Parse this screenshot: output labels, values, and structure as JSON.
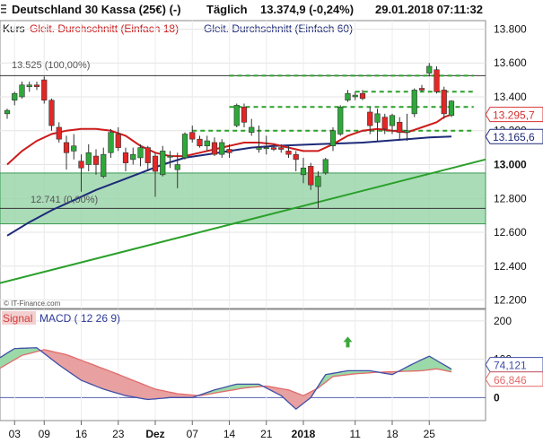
{
  "header": {
    "instrument": "Deutschland 30 Kassa (25€) (-)",
    "period": "Täglich",
    "last": "13.374,9 (-0,24%)",
    "datetime": "29.01.2018 07:11:32"
  },
  "legend": {
    "kurs": "Kurs",
    "ma_short": "Gleit. Durchschnitt (Einfach 18)",
    "ma_long": "Gleit. Durchschnitt (Einfach 60)"
  },
  "watermark": "© IT-Finance.com",
  "colors": {
    "up": "#2fa83a",
    "down": "#e32626",
    "ma18": "#cc1b1b",
    "ma60": "#1d2a78",
    "trend": "#2aa02a",
    "zone_fill": "#8fd0a0",
    "macd": "#3e4fa8",
    "signal": "#e26b6b",
    "macd_fill_up": "#9bd9a8",
    "macd_fill_down": "#e8a0a0",
    "badge_price": "#d63030",
    "badge_ma60": "#1d2a78"
  },
  "chart_data": [
    {
      "type": "candlestick",
      "title": "Deutschland 30 Kassa (25€) (-)",
      "ylim": [
        12150,
        13850
      ],
      "y_ticks": [
        "13.800",
        "13.600",
        "13.400",
        "13.200",
        "13.000",
        "12.800",
        "12.600",
        "12.400",
        "12.200"
      ],
      "y_tick_values": [
        13800,
        13600,
        13400,
        13200,
        13000,
        12800,
        12600,
        12400,
        12200
      ],
      "x_tick_labels": [
        "03",
        "09",
        "16",
        "23",
        "Dez",
        "07",
        "14",
        "21",
        "2018",
        "11",
        "18",
        "25"
      ],
      "x_tick_index": [
        1,
        5,
        10,
        15,
        20,
        25,
        30,
        35,
        40,
        47,
        52,
        57
      ],
      "candles": [
        {
          "o": 13300,
          "h": 13330,
          "l": 13270,
          "c": 13320
        },
        {
          "o": 13380,
          "h": 13430,
          "l": 13350,
          "c": 13420
        },
        {
          "o": 13400,
          "h": 13490,
          "l": 13390,
          "c": 13470
        },
        {
          "o": 13460,
          "h": 13490,
          "l": 13430,
          "c": 13470
        },
        {
          "o": 13470,
          "h": 13490,
          "l": 13440,
          "c": 13460
        },
        {
          "o": 13500,
          "h": 13520,
          "l": 13360,
          "c": 13380
        },
        {
          "o": 13380,
          "h": 13390,
          "l": 13200,
          "c": 13230
        },
        {
          "o": 13220,
          "h": 13250,
          "l": 13130,
          "c": 13150
        },
        {
          "o": 13130,
          "h": 13170,
          "l": 12970,
          "c": 13070
        },
        {
          "o": 13080,
          "h": 13180,
          "l": 13030,
          "c": 13110
        },
        {
          "o": 13020,
          "h": 13060,
          "l": 12840,
          "c": 12980
        },
        {
          "o": 13000,
          "h": 13120,
          "l": 12960,
          "c": 13070
        },
        {
          "o": 13050,
          "h": 13090,
          "l": 12940,
          "c": 13000
        },
        {
          "o": 12930,
          "h": 13100,
          "l": 12920,
          "c": 13060
        },
        {
          "o": 13070,
          "h": 13210,
          "l": 13040,
          "c": 13190
        },
        {
          "o": 13180,
          "h": 13220,
          "l": 13080,
          "c": 13100
        },
        {
          "o": 13070,
          "h": 13100,
          "l": 12960,
          "c": 13010
        },
        {
          "o": 13030,
          "h": 13100,
          "l": 13000,
          "c": 13060
        },
        {
          "o": 13040,
          "h": 13120,
          "l": 12990,
          "c": 13100
        },
        {
          "o": 13100,
          "h": 13110,
          "l": 12960,
          "c": 13010
        },
        {
          "o": 13050,
          "h": 13070,
          "l": 12810,
          "c": 12960
        },
        {
          "o": 12940,
          "h": 13110,
          "l": 12930,
          "c": 13080
        },
        {
          "o": 13050,
          "h": 13080,
          "l": 12980,
          "c": 13050
        },
        {
          "o": 12970,
          "h": 13070,
          "l": 12860,
          "c": 13000
        },
        {
          "o": 13040,
          "h": 13190,
          "l": 13030,
          "c": 13180
        },
        {
          "o": 13190,
          "h": 13230,
          "l": 13130,
          "c": 13150
        },
        {
          "o": 13150,
          "h": 13170,
          "l": 13100,
          "c": 13110
        },
        {
          "o": 13110,
          "h": 13170,
          "l": 13080,
          "c": 13140
        },
        {
          "o": 13130,
          "h": 13160,
          "l": 13050,
          "c": 13060
        },
        {
          "o": 13060,
          "h": 13150,
          "l": 13040,
          "c": 13130
        },
        {
          "o": 13090,
          "h": 13120,
          "l": 13040,
          "c": 13070
        },
        {
          "o": 13230,
          "h": 13360,
          "l": 13220,
          "c": 13350
        },
        {
          "o": 13340,
          "h": 13360,
          "l": 13220,
          "c": 13250
        },
        {
          "o": 13190,
          "h": 13270,
          "l": 13170,
          "c": 13220
        },
        {
          "o": 13090,
          "h": 13230,
          "l": 13070,
          "c": 13100
        },
        {
          "o": 13100,
          "h": 13170,
          "l": 13060,
          "c": 13100
        },
        {
          "o": 13100,
          "h": 13120,
          "l": 13080,
          "c": 13090
        },
        {
          "o": 13100,
          "h": 13120,
          "l": 13070,
          "c": 13090
        },
        {
          "o": 13080,
          "h": 13110,
          "l": 13040,
          "c": 13060
        },
        {
          "o": 13060,
          "h": 13080,
          "l": 12960,
          "c": 13030
        },
        {
          "o": 12940,
          "h": 13040,
          "l": 12890,
          "c": 12980
        },
        {
          "o": 12990,
          "h": 13010,
          "l": 12850,
          "c": 12880
        },
        {
          "o": 12870,
          "h": 12960,
          "l": 12740,
          "c": 12930
        },
        {
          "o": 12950,
          "h": 13040,
          "l": 12940,
          "c": 13030
        },
        {
          "o": 13110,
          "h": 13220,
          "l": 13080,
          "c": 13200
        },
        {
          "o": 13180,
          "h": 13350,
          "l": 13170,
          "c": 13340
        },
        {
          "o": 13380,
          "h": 13440,
          "l": 13370,
          "c": 13420
        },
        {
          "o": 13400,
          "h": 13430,
          "l": 13380,
          "c": 13410
        },
        {
          "o": 13420,
          "h": 13440,
          "l": 13380,
          "c": 13390
        },
        {
          "o": 13310,
          "h": 13340,
          "l": 13180,
          "c": 13230
        },
        {
          "o": 13250,
          "h": 13330,
          "l": 13140,
          "c": 13300
        },
        {
          "o": 13280,
          "h": 13300,
          "l": 13180,
          "c": 13210
        },
        {
          "o": 13230,
          "h": 13300,
          "l": 13180,
          "c": 13290
        },
        {
          "o": 13250,
          "h": 13280,
          "l": 13150,
          "c": 13190
        },
        {
          "o": 13190,
          "h": 13300,
          "l": 13140,
          "c": 13200
        },
        {
          "o": 13300,
          "h": 13450,
          "l": 13280,
          "c": 13440
        },
        {
          "o": 13450,
          "h": 13470,
          "l": 13430,
          "c": 13440
        },
        {
          "o": 13540,
          "h": 13600,
          "l": 13520,
          "c": 13580
        },
        {
          "o": 13560,
          "h": 13580,
          "l": 13420,
          "c": 13430
        },
        {
          "o": 13440,
          "h": 13460,
          "l": 13270,
          "c": 13300
        },
        {
          "o": 13290,
          "h": 13380,
          "l": 13280,
          "c": 13374.9
        }
      ],
      "ma18": [
        {
          "i": 0,
          "v": 13000
        },
        {
          "i": 2,
          "v": 13080
        },
        {
          "i": 4,
          "v": 13140
        },
        {
          "i": 6,
          "v": 13180
        },
        {
          "i": 8,
          "v": 13200
        },
        {
          "i": 10,
          "v": 13210
        },
        {
          "i": 12,
          "v": 13210
        },
        {
          "i": 14,
          "v": 13200
        },
        {
          "i": 16,
          "v": 13170
        },
        {
          "i": 18,
          "v": 13110
        },
        {
          "i": 20,
          "v": 13070
        },
        {
          "i": 22,
          "v": 13050
        },
        {
          "i": 24,
          "v": 13050
        },
        {
          "i": 26,
          "v": 13070
        },
        {
          "i": 28,
          "v": 13090
        },
        {
          "i": 30,
          "v": 13110
        },
        {
          "i": 32,
          "v": 13130
        },
        {
          "i": 34,
          "v": 13130
        },
        {
          "i": 36,
          "v": 13120
        },
        {
          "i": 38,
          "v": 13100
        },
        {
          "i": 40,
          "v": 13080
        },
        {
          "i": 42,
          "v": 13080
        },
        {
          "i": 44,
          "v": 13120
        },
        {
          "i": 46,
          "v": 13170
        },
        {
          "i": 48,
          "v": 13200
        },
        {
          "i": 50,
          "v": 13210
        },
        {
          "i": 52,
          "v": 13200
        },
        {
          "i": 54,
          "v": 13190
        },
        {
          "i": 56,
          "v": 13220
        },
        {
          "i": 58,
          "v": 13250
        },
        {
          "i": 59,
          "v": 13280
        },
        {
          "i": 60,
          "v": 13295.7
        }
      ],
      "ma60": [
        {
          "i": 0,
          "v": 12580
        },
        {
          "i": 3,
          "v": 12660
        },
        {
          "i": 6,
          "v": 12730
        },
        {
          "i": 9,
          "v": 12790
        },
        {
          "i": 12,
          "v": 12850
        },
        {
          "i": 15,
          "v": 12900
        },
        {
          "i": 18,
          "v": 12950
        },
        {
          "i": 21,
          "v": 13000
        },
        {
          "i": 24,
          "v": 13040
        },
        {
          "i": 27,
          "v": 13060
        },
        {
          "i": 30,
          "v": 13080
        },
        {
          "i": 33,
          "v": 13100
        },
        {
          "i": 36,
          "v": 13110
        },
        {
          "i": 39,
          "v": 13115
        },
        {
          "i": 42,
          "v": 13120
        },
        {
          "i": 45,
          "v": 13125
        },
        {
          "i": 48,
          "v": 13130
        },
        {
          "i": 51,
          "v": 13140
        },
        {
          "i": 54,
          "v": 13150
        },
        {
          "i": 57,
          "v": 13160
        },
        {
          "i": 60,
          "v": 13165.6
        }
      ],
      "trendline": [
        {
          "i": -1,
          "v": 12300
        },
        {
          "i": 63,
          "v": 13030
        }
      ],
      "fib": {
        "high": {
          "label": "13.525 (100,00%)",
          "value": 13525
        },
        "low": {
          "label": "12.741 (0,00%)",
          "value": 12741
        }
      },
      "support_zone": [
        12650,
        12950
      ],
      "resistance_levels": [
        {
          "value": 13525,
          "from": 30,
          "to": 63
        },
        {
          "value": 13430,
          "from": 47,
          "to": 63
        },
        {
          "value": 13340,
          "from": 30,
          "to": 63
        },
        {
          "value": 13200,
          "from": 25,
          "to": 63
        }
      ],
      "badges": [
        {
          "label": "13.295,7",
          "value": 13295.7
        },
        {
          "label": "13.165,6",
          "value": 13165.6
        }
      ]
    },
    {
      "type": "line",
      "title": "MACD ( 12 26 9)",
      "series_labels": [
        "Signal",
        "MACD ( 12 26 9)"
      ],
      "ylim": [
        -60,
        230
      ],
      "y_ticks": [
        "200",
        "100",
        "0"
      ],
      "y_tick_values": [
        200,
        100,
        0
      ],
      "signal": [
        {
          "i": -2,
          "v": 65
        },
        {
          "i": 2,
          "v": 110
        },
        {
          "i": 5,
          "v": 125
        },
        {
          "i": 8,
          "v": 112
        },
        {
          "i": 11,
          "v": 90
        },
        {
          "i": 14,
          "v": 68
        },
        {
          "i": 17,
          "v": 45
        },
        {
          "i": 20,
          "v": 22
        },
        {
          "i": 23,
          "v": 10
        },
        {
          "i": 26,
          "v": 5
        },
        {
          "i": 29,
          "v": 15
        },
        {
          "i": 32,
          "v": 25
        },
        {
          "i": 35,
          "v": 30
        },
        {
          "i": 38,
          "v": 20
        },
        {
          "i": 40,
          "v": 5
        },
        {
          "i": 42,
          "v": 25
        },
        {
          "i": 44,
          "v": 55
        },
        {
          "i": 47,
          "v": 62
        },
        {
          "i": 50,
          "v": 66
        },
        {
          "i": 53,
          "v": 68
        },
        {
          "i": 56,
          "v": 70
        },
        {
          "i": 58,
          "v": 75
        },
        {
          "i": 60,
          "v": 66.846
        }
      ],
      "macd": [
        {
          "i": -2,
          "v": 92
        },
        {
          "i": 1,
          "v": 128
        },
        {
          "i": 4,
          "v": 130
        },
        {
          "i": 7,
          "v": 85
        },
        {
          "i": 10,
          "v": 45
        },
        {
          "i": 13,
          "v": 22
        },
        {
          "i": 16,
          "v": 5
        },
        {
          "i": 19,
          "v": -5
        },
        {
          "i": 22,
          "v": 0
        },
        {
          "i": 25,
          "v": 0
        },
        {
          "i": 28,
          "v": 20
        },
        {
          "i": 31,
          "v": 35
        },
        {
          "i": 34,
          "v": 35
        },
        {
          "i": 37,
          "v": 5
        },
        {
          "i": 39,
          "v": -30
        },
        {
          "i": 41,
          "v": 0
        },
        {
          "i": 43,
          "v": 60
        },
        {
          "i": 46,
          "v": 70
        },
        {
          "i": 49,
          "v": 70
        },
        {
          "i": 52,
          "v": 60
        },
        {
          "i": 55,
          "v": 90
        },
        {
          "i": 57,
          "v": 108
        },
        {
          "i": 60,
          "v": 74.121
        }
      ],
      "badges": [
        {
          "label": "74,121",
          "value": 74.121
        },
        {
          "label": "66,846",
          "value": 66.846
        }
      ],
      "arrow_at": {
        "i": 46,
        "v": 145
      }
    }
  ]
}
